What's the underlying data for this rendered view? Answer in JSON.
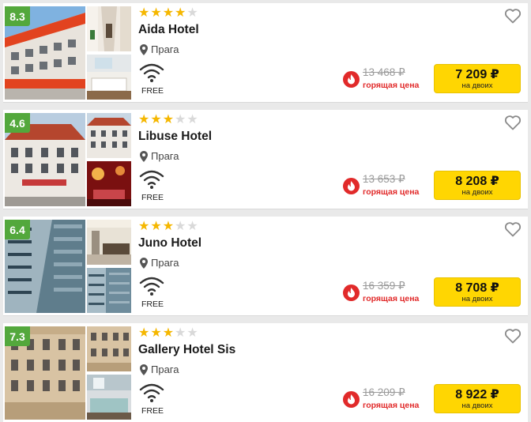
{
  "colors": {
    "score_badge": "#53a83c",
    "star_filled": "#f5b700",
    "star_empty": "#d9d9d9",
    "price_button": "#ffd602",
    "hot_text": "#e12a2a"
  },
  "icons": {
    "location": "map-pin-icon",
    "wifi": "wifi-icon",
    "favorite": "heart-outline-icon",
    "hot_deal": "fire-icon"
  },
  "hotels": [
    {
      "score": "8.3",
      "stars": 4,
      "stars_max": 5,
      "name": "Aida Hotel",
      "city": "Прага",
      "wifi_label": "FREE",
      "old_price": "13 468 ₽",
      "hot_label": "горящая цена",
      "price": "7 209 ₽",
      "price_note": "на двоих"
    },
    {
      "score": "4.6",
      "stars": 3,
      "stars_max": 5,
      "name": "Libuse Hotel",
      "city": "Прага",
      "wifi_label": "FREE",
      "old_price": "13 653 ₽",
      "hot_label": "горящая цена",
      "price": "8 208 ₽",
      "price_note": "на двоих"
    },
    {
      "score": "6.4",
      "stars": 3,
      "stars_max": 5,
      "name": "Juno Hotel",
      "city": "Прага",
      "wifi_label": "FREE",
      "old_price": "16 359 ₽",
      "hot_label": "горящая цена",
      "price": "8 708 ₽",
      "price_note": "на двоих"
    },
    {
      "score": "7.3",
      "stars": 3,
      "stars_max": 5,
      "name": "Gallery Hotel Sis",
      "city": "Прага",
      "wifi_label": "FREE",
      "old_price": "16 209 ₽",
      "hot_label": "горящая цена",
      "price": "8 922 ₽",
      "price_note": "на двоих"
    }
  ]
}
